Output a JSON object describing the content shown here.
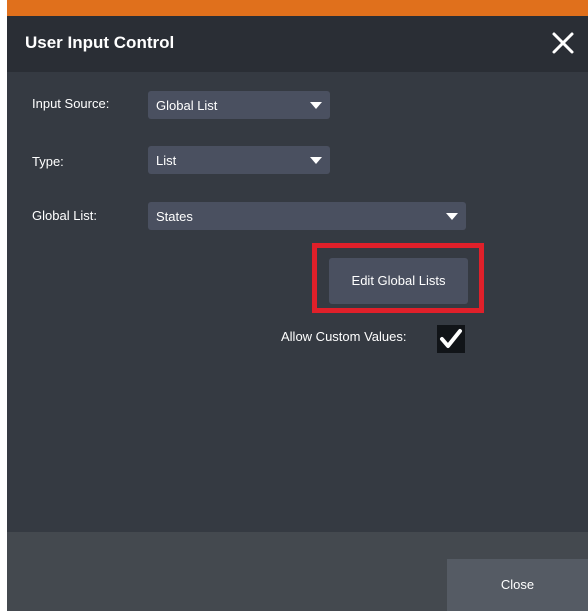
{
  "dialog": {
    "title": "User Input Control",
    "close_icon": "close-icon"
  },
  "form": {
    "input_source": {
      "label": "Input Source:",
      "value": "Global List"
    },
    "type": {
      "label": "Type:",
      "value": "List"
    },
    "global_list": {
      "label": "Global List:",
      "value": "States"
    },
    "edit_global_lists_label": "Edit Global Lists",
    "allow_custom_values": {
      "label": "Allow Custom Values:",
      "checked": true
    }
  },
  "footer": {
    "close_label": "Close"
  },
  "colors": {
    "accent_orange": "#e0701c",
    "highlight_red": "#e0202a",
    "dialog_bg": "#353a42",
    "titlebar_bg": "#2a2e35",
    "control_bg": "#4a5060"
  }
}
